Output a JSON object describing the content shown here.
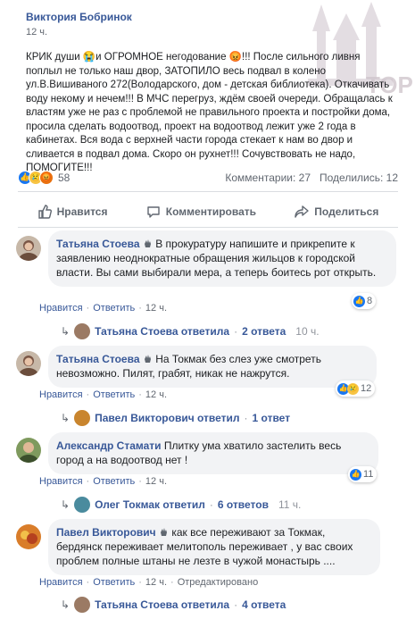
{
  "post": {
    "author": "Виктория Бобринок",
    "time": "12 ч.",
    "text": "КРИК души 😭и ОГРОМНОЕ негодование 😡!!! После сильного ливня поплыл не только наш двор, ЗАТОПИЛО весь подвал в колено ул.В.Вишиваного 272(Володарского, дом - детская библиотека). Откачивать воду некому и нечем!!! В МЧС перегруз, ждём своей очереди. Обращалась к властям уже не раз с проблемой не правильного проекта и постройки дома, просила сделать водоотвод, проект на водоотвод лежит уже 2 года в кабинетах. Вся вода с верхней части города стекает к нам во двор и сливается в подвал дома. Скоро он рухнет!!! Сочувствовать не надо, ПОМОГИТЕ!!!",
    "reaction_count": "58",
    "comments_label": "Комментарии: 27",
    "shares_label": "Поделились: 12"
  },
  "actions": {
    "like": "Нравится",
    "comment": "Комментировать",
    "share": "Поделиться"
  },
  "comments": [
    {
      "name": "Татьяна Стоева",
      "text_line1": "В прокуратуру напишите и прикрепите к",
      "text_rest": "заявлению неоднократные обращения жильцов к городской власти. Вы сами выбирали мера, а теперь боитесь рот открыть.",
      "reactions": "8",
      "like_link": "Нравится",
      "reply_link": "Ответить",
      "time": "12 ч.",
      "reply_author": "Татьяна Стоева ответила",
      "reply_count": "2 ответа",
      "reply_time": "10 ч."
    },
    {
      "name": "Татьяна Стоева",
      "text_line1": "На Токмак без слез уже смотреть",
      "text_rest": "невозможно. Пилят, грабят, никак не нажрутся.",
      "reactions": "12",
      "like_link": "Нравится",
      "reply_link": "Ответить",
      "time": "12 ч.",
      "reply_author": "Павел Викторович ответил",
      "reply_count": "1 ответ",
      "reply_time": ""
    },
    {
      "name": "Александр Стамати",
      "text_line1": "Плитку ума хватило застелить весь город",
      "text_rest": "а на водоотвод нет !",
      "reactions": "11",
      "like_link": "Нравится",
      "reply_link": "Ответить",
      "time": "12 ч.",
      "reply_author": "Олег Токмак ответил",
      "reply_count": "6 ответов",
      "reply_time": "11 ч."
    },
    {
      "name": "Павел Викторович",
      "text_line1": "как все переживают за Токмак,",
      "text_rest": "бердянск переживает мелитополь переживает , у вас своих проблем полные штаны не лезте в чужой монастырь ....",
      "reactions": "",
      "like_link": "Нравится",
      "reply_link": "Ответить",
      "time": "12 ч.",
      "edited": "Отредактировано",
      "reply_author": "Татьяна Стоева ответила",
      "reply_count": "4 ответа",
      "reply_time": ""
    }
  ],
  "watermark": "ТОР",
  "colors": {
    "link": "#385898",
    "bubble": "#f2f3f5",
    "like_blue": "#1877f2"
  }
}
